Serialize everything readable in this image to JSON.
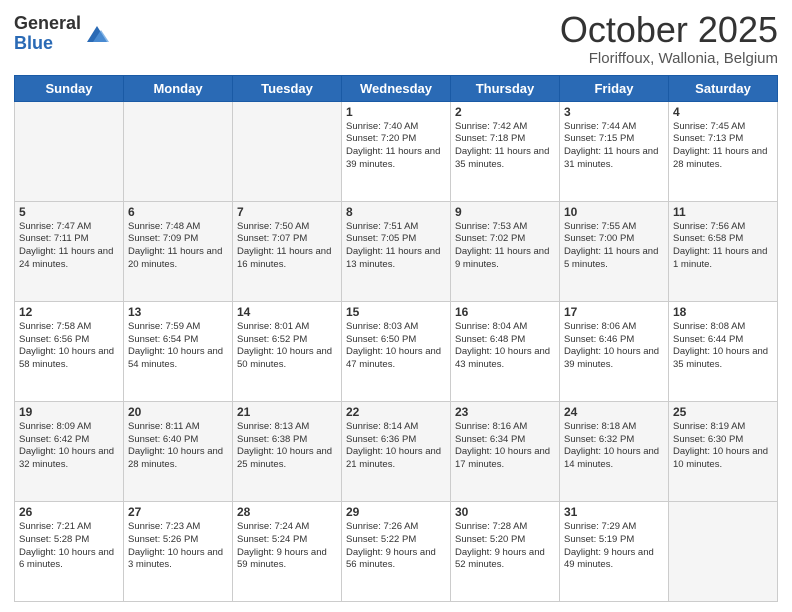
{
  "header": {
    "logo_general": "General",
    "logo_blue": "Blue",
    "month": "October 2025",
    "location": "Floriffoux, Wallonia, Belgium"
  },
  "days_of_week": [
    "Sunday",
    "Monday",
    "Tuesday",
    "Wednesday",
    "Thursday",
    "Friday",
    "Saturday"
  ],
  "weeks": [
    [
      {
        "day": "",
        "info": ""
      },
      {
        "day": "",
        "info": ""
      },
      {
        "day": "",
        "info": ""
      },
      {
        "day": "1",
        "info": "Sunrise: 7:40 AM\nSunset: 7:20 PM\nDaylight: 11 hours\nand 39 minutes."
      },
      {
        "day": "2",
        "info": "Sunrise: 7:42 AM\nSunset: 7:18 PM\nDaylight: 11 hours\nand 35 minutes."
      },
      {
        "day": "3",
        "info": "Sunrise: 7:44 AM\nSunset: 7:15 PM\nDaylight: 11 hours\nand 31 minutes."
      },
      {
        "day": "4",
        "info": "Sunrise: 7:45 AM\nSunset: 7:13 PM\nDaylight: 11 hours\nand 28 minutes."
      }
    ],
    [
      {
        "day": "5",
        "info": "Sunrise: 7:47 AM\nSunset: 7:11 PM\nDaylight: 11 hours\nand 24 minutes."
      },
      {
        "day": "6",
        "info": "Sunrise: 7:48 AM\nSunset: 7:09 PM\nDaylight: 11 hours\nand 20 minutes."
      },
      {
        "day": "7",
        "info": "Sunrise: 7:50 AM\nSunset: 7:07 PM\nDaylight: 11 hours\nand 16 minutes."
      },
      {
        "day": "8",
        "info": "Sunrise: 7:51 AM\nSunset: 7:05 PM\nDaylight: 11 hours\nand 13 minutes."
      },
      {
        "day": "9",
        "info": "Sunrise: 7:53 AM\nSunset: 7:02 PM\nDaylight: 11 hours\nand 9 minutes."
      },
      {
        "day": "10",
        "info": "Sunrise: 7:55 AM\nSunset: 7:00 PM\nDaylight: 11 hours\nand 5 minutes."
      },
      {
        "day": "11",
        "info": "Sunrise: 7:56 AM\nSunset: 6:58 PM\nDaylight: 11 hours\nand 1 minute."
      }
    ],
    [
      {
        "day": "12",
        "info": "Sunrise: 7:58 AM\nSunset: 6:56 PM\nDaylight: 10 hours\nand 58 minutes."
      },
      {
        "day": "13",
        "info": "Sunrise: 7:59 AM\nSunset: 6:54 PM\nDaylight: 10 hours\nand 54 minutes."
      },
      {
        "day": "14",
        "info": "Sunrise: 8:01 AM\nSunset: 6:52 PM\nDaylight: 10 hours\nand 50 minutes."
      },
      {
        "day": "15",
        "info": "Sunrise: 8:03 AM\nSunset: 6:50 PM\nDaylight: 10 hours\nand 47 minutes."
      },
      {
        "day": "16",
        "info": "Sunrise: 8:04 AM\nSunset: 6:48 PM\nDaylight: 10 hours\nand 43 minutes."
      },
      {
        "day": "17",
        "info": "Sunrise: 8:06 AM\nSunset: 6:46 PM\nDaylight: 10 hours\nand 39 minutes."
      },
      {
        "day": "18",
        "info": "Sunrise: 8:08 AM\nSunset: 6:44 PM\nDaylight: 10 hours\nand 35 minutes."
      }
    ],
    [
      {
        "day": "19",
        "info": "Sunrise: 8:09 AM\nSunset: 6:42 PM\nDaylight: 10 hours\nand 32 minutes."
      },
      {
        "day": "20",
        "info": "Sunrise: 8:11 AM\nSunset: 6:40 PM\nDaylight: 10 hours\nand 28 minutes."
      },
      {
        "day": "21",
        "info": "Sunrise: 8:13 AM\nSunset: 6:38 PM\nDaylight: 10 hours\nand 25 minutes."
      },
      {
        "day": "22",
        "info": "Sunrise: 8:14 AM\nSunset: 6:36 PM\nDaylight: 10 hours\nand 21 minutes."
      },
      {
        "day": "23",
        "info": "Sunrise: 8:16 AM\nSunset: 6:34 PM\nDaylight: 10 hours\nand 17 minutes."
      },
      {
        "day": "24",
        "info": "Sunrise: 8:18 AM\nSunset: 6:32 PM\nDaylight: 10 hours\nand 14 minutes."
      },
      {
        "day": "25",
        "info": "Sunrise: 8:19 AM\nSunset: 6:30 PM\nDaylight: 10 hours\nand 10 minutes."
      }
    ],
    [
      {
        "day": "26",
        "info": "Sunrise: 7:21 AM\nSunset: 5:28 PM\nDaylight: 10 hours\nand 6 minutes."
      },
      {
        "day": "27",
        "info": "Sunrise: 7:23 AM\nSunset: 5:26 PM\nDaylight: 10 hours\nand 3 minutes."
      },
      {
        "day": "28",
        "info": "Sunrise: 7:24 AM\nSunset: 5:24 PM\nDaylight: 9 hours\nand 59 minutes."
      },
      {
        "day": "29",
        "info": "Sunrise: 7:26 AM\nSunset: 5:22 PM\nDaylight: 9 hours\nand 56 minutes."
      },
      {
        "day": "30",
        "info": "Sunrise: 7:28 AM\nSunset: 5:20 PM\nDaylight: 9 hours\nand 52 minutes."
      },
      {
        "day": "31",
        "info": "Sunrise: 7:29 AM\nSunset: 5:19 PM\nDaylight: 9 hours\nand 49 minutes."
      },
      {
        "day": "",
        "info": ""
      }
    ]
  ]
}
